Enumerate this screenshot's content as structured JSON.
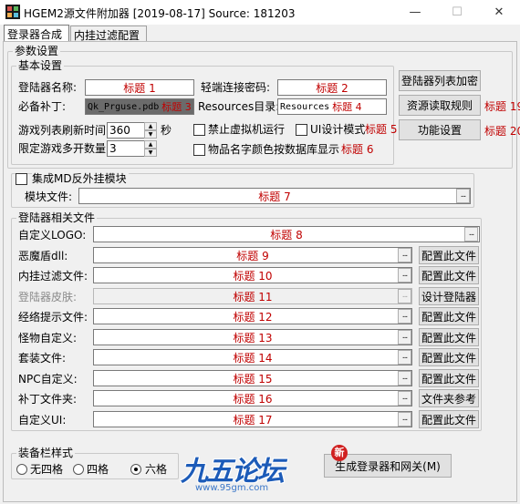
{
  "window": {
    "title": "HGEM2源文件附加器 [2019-08-17] Source: 181203",
    "minimize_glyph": "—",
    "maximize_glyph": "☐",
    "close_glyph": "✕"
  },
  "tabs": [
    {
      "label": "登录器合成",
      "active": true
    },
    {
      "label": "内挂过滤配置",
      "active": false
    }
  ],
  "params": {
    "legend": "参数设置",
    "basic": {
      "legend": "基本设置",
      "launcher_name_label": "登陆器名称:",
      "launcher_name_value": "标题 1",
      "light_pw_label": "轻端连接密码:",
      "light_pw_value": "标题 2",
      "patch_label": "必备补丁:",
      "patch_value": "Qk_Prguse.pdb",
      "patch_tag": "标题 3",
      "resources_label": "Resources目录:",
      "resources_value": "Resources",
      "resources_tag": "标题 4",
      "refresh_label": "游戏列表刷新时间",
      "refresh_value": "360",
      "refresh_unit": "秒",
      "multi_label": "限定游戏多开数量",
      "multi_value": "3",
      "disable_vm_label": "禁止虚拟机运行",
      "ui_mode_label": "UI设计模式",
      "ui_mode_tag": "标题 5",
      "item_color_label": "物品名字颜色按数据库显示",
      "item_color_tag": "标题 6"
    },
    "buttons": {
      "encrypt": "登陆器列表加密",
      "read_rules": "资源读取规则",
      "read_rules_tag": "标题 19",
      "features": "功能设置",
      "features_tag": "标题 20"
    }
  },
  "anticheat": {
    "legend": "集成MD反外挂模块",
    "module_label": "模块文件:",
    "module_value": "标题 7"
  },
  "files": {
    "legend": "登陆器相关文件",
    "dots": "...",
    "rows": [
      {
        "label": "自定义LOGO:",
        "value": "标题 8",
        "button": ""
      },
      {
        "label": "恶魔盾dll:",
        "value": "标题 9",
        "button": "配置此文件"
      },
      {
        "label": "内挂过滤文件:",
        "value": "标题 10",
        "button": "配置此文件"
      },
      {
        "label": "登陆器皮肤:",
        "value": "标题 11",
        "button": "设计登陆器"
      },
      {
        "label": "经络提示文件:",
        "value": "标题 12",
        "button": "配置此文件"
      },
      {
        "label": "怪物自定义:",
        "value": "标题 13",
        "button": "配置此文件"
      },
      {
        "label": "套装文件:",
        "value": "标题 14",
        "button": "配置此文件"
      },
      {
        "label": "NPC自定义:",
        "value": "标题 15",
        "button": "配置此文件"
      },
      {
        "label": "补丁文件夹:",
        "value": "标题 16",
        "button": "文件夹参考"
      },
      {
        "label": "自定义UI:",
        "value": "标题 17",
        "button": "配置此文件"
      }
    ]
  },
  "equip": {
    "legend": "装备栏样式",
    "options": [
      "无四格",
      "四格",
      "六格"
    ],
    "selected": "六格"
  },
  "generate_button": "生成登录器和网关(M)",
  "watermark": {
    "text": "九五论坛",
    "badge": "新",
    "url": "www.95gm.com"
  },
  "colors": {
    "tag_red": "#c00000",
    "watermark_blue": "#1c5bb8"
  }
}
